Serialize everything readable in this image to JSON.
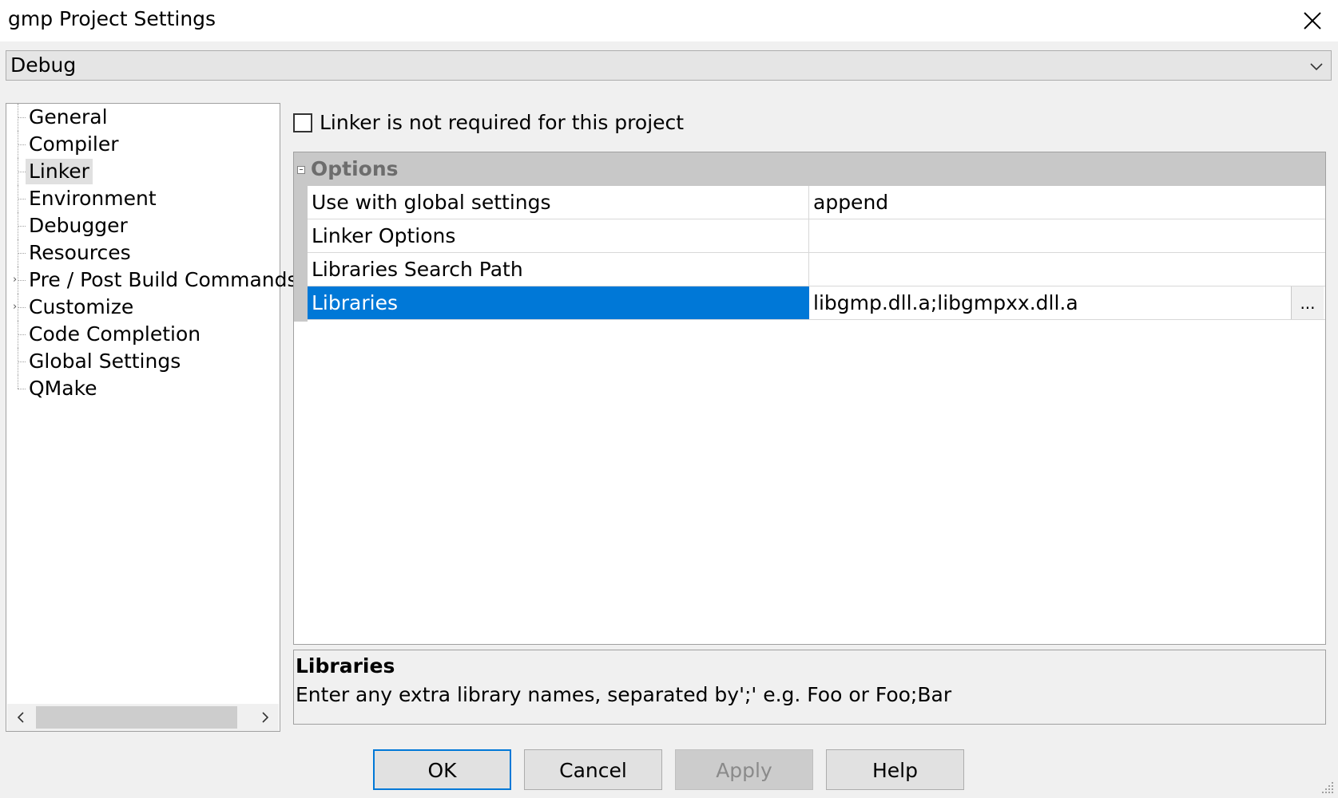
{
  "window": {
    "title": "gmp Project Settings"
  },
  "config": {
    "selected": "Debug"
  },
  "tree": {
    "items": [
      {
        "label": "General",
        "expandable": false,
        "selected": false
      },
      {
        "label": "Compiler",
        "expandable": false,
        "selected": false
      },
      {
        "label": "Linker",
        "expandable": false,
        "selected": true
      },
      {
        "label": "Environment",
        "expandable": false,
        "selected": false
      },
      {
        "label": "Debugger",
        "expandable": false,
        "selected": false
      },
      {
        "label": "Resources",
        "expandable": false,
        "selected": false
      },
      {
        "label": "Pre / Post Build Commands",
        "expandable": true,
        "selected": false
      },
      {
        "label": "Customize",
        "expandable": true,
        "selected": false
      },
      {
        "label": "Code Completion",
        "expandable": false,
        "selected": false
      },
      {
        "label": "Global Settings",
        "expandable": false,
        "selected": false
      },
      {
        "label": "QMake",
        "expandable": false,
        "selected": false
      }
    ]
  },
  "linker_not_required": {
    "label": "Linker is not required for this project",
    "checked": false
  },
  "grid": {
    "category": "Options",
    "rows": [
      {
        "name": "Use with global settings",
        "value": "append",
        "selected": false
      },
      {
        "name": "Linker Options",
        "value": "",
        "selected": false
      },
      {
        "name": "Libraries Search Path",
        "value": "",
        "selected": false
      },
      {
        "name": "Libraries",
        "value": "libgmp.dll.a;libgmpxx.dll.a",
        "selected": true
      }
    ],
    "ellipsis_label": "..."
  },
  "description": {
    "title": "Libraries",
    "text": "Enter any extra library names, separated by';' e.g. Foo  or  Foo;Bar"
  },
  "buttons": {
    "ok": "OK",
    "cancel": "Cancel",
    "apply": "Apply",
    "help": "Help"
  },
  "colors": {
    "selection": "#0078d7",
    "default_button_border": "#0078d7"
  }
}
